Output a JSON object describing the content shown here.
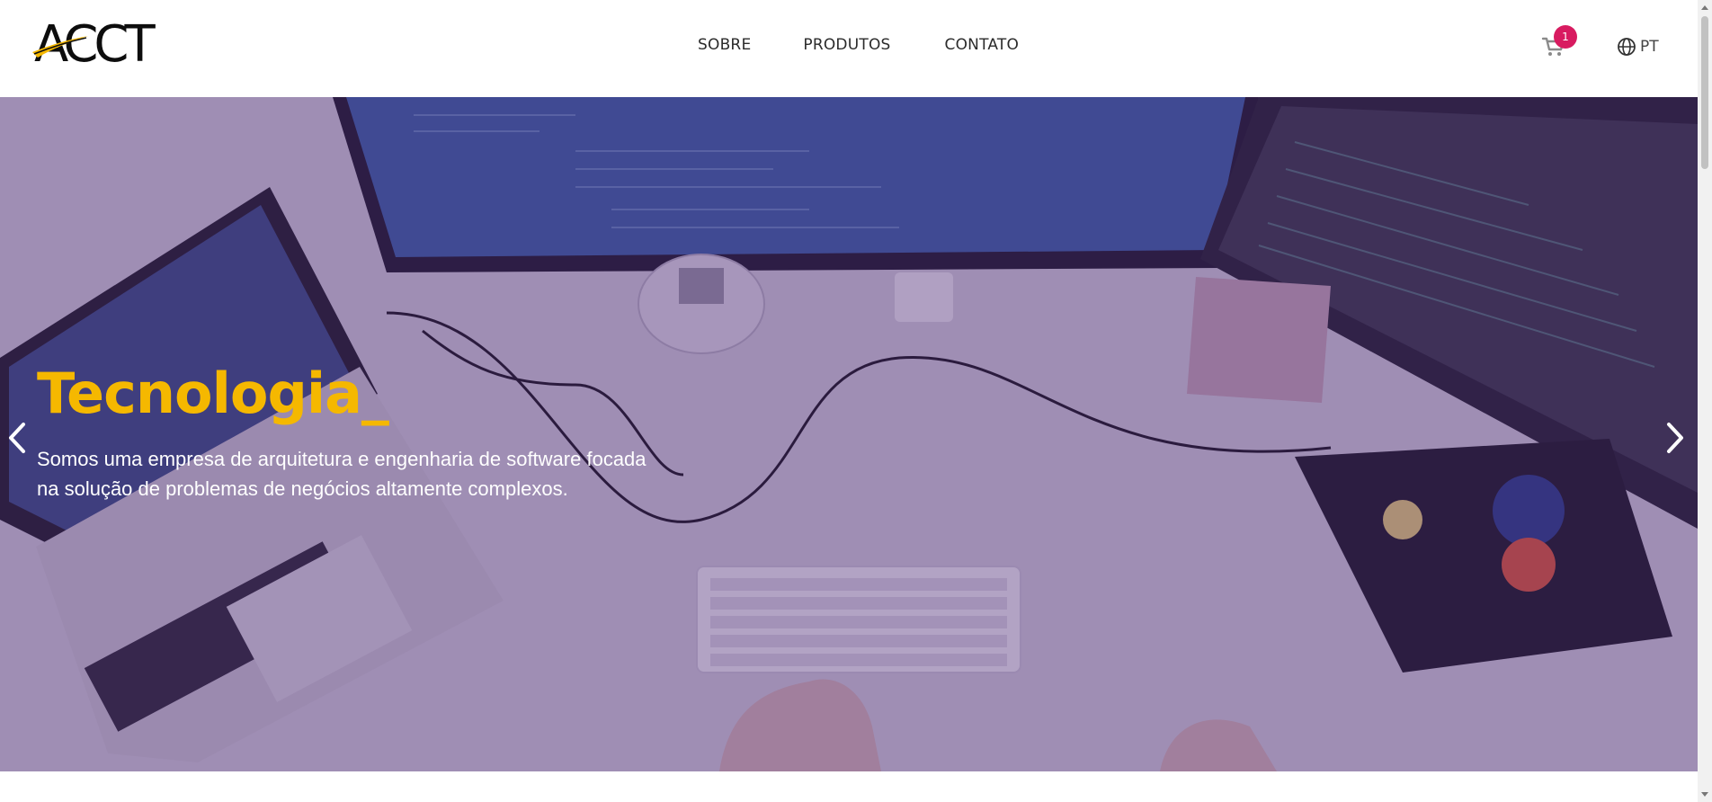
{
  "header": {
    "logo_text": "ACCT",
    "nav": [
      {
        "label": "SOBRE"
      },
      {
        "label": "PRODUTOS"
      },
      {
        "label": "CONTATO"
      }
    ],
    "cart": {
      "icon": "cart-icon",
      "count": "1",
      "badge_color": "#d81b60"
    },
    "language": {
      "icon": "globe-icon",
      "label": "PT"
    }
  },
  "hero": {
    "title": "Tecnologia_",
    "description_lines": [
      "Somos uma empresa de arquitetura e engenharia de software focada",
      "na solução de problemas de negócios altamente complexos."
    ],
    "title_color": "#f5b800",
    "overlay_color": "#462270",
    "prev_icon": "chevron-left-icon",
    "next_icon": "chevron-right-icon"
  }
}
